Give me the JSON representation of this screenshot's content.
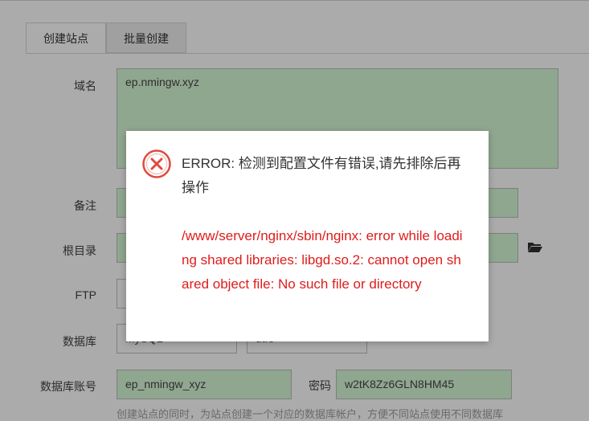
{
  "tabs": [
    {
      "label": "创建站点",
      "active": true
    },
    {
      "label": "批量创建",
      "active": false
    }
  ],
  "form": {
    "domain_label": "域名",
    "domain_value": "ep.nmingw.xyz",
    "remark_label": "备注",
    "root_label": "根目录",
    "ftp_label": "FTP",
    "db_label": "数据库",
    "db_type": "MySQL",
    "db_charset": "utf8",
    "db_account_label": "数据库账号",
    "db_account_value": "ep_nmingw_xyz",
    "password_label": "密码",
    "password_value": "w2tK8Zz6GLN8HM45",
    "hint": "创建站点的同时，为站点创建一个对应的数据库帐户，方便不同站点使用不同数据库"
  },
  "dialog": {
    "title": "ERROR: 检测到配置文件有错误,请先排除后再操作",
    "detail": "/www/server/nginx/sbin/nginx: error while loading shared libraries: libgd.so.2: cannot open shared object file: No such file or directory",
    "icon": "error-circle-icon",
    "accent_color": "#e01b1b"
  },
  "colors": {
    "overlay": "#ababab",
    "field_bg": "#8fa68f"
  }
}
